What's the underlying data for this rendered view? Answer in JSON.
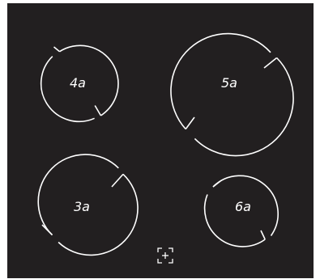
{
  "cooktop": {
    "surface_color": "#221f20",
    "marking_color": "#ffffff",
    "zones": [
      {
        "id": "front-left",
        "label": "4a"
      },
      {
        "id": "front-right",
        "label": "5a"
      },
      {
        "id": "rear-left",
        "label": "3a"
      },
      {
        "id": "rear-right",
        "label": "6a"
      }
    ],
    "control_icon": "touch-control-icon"
  }
}
